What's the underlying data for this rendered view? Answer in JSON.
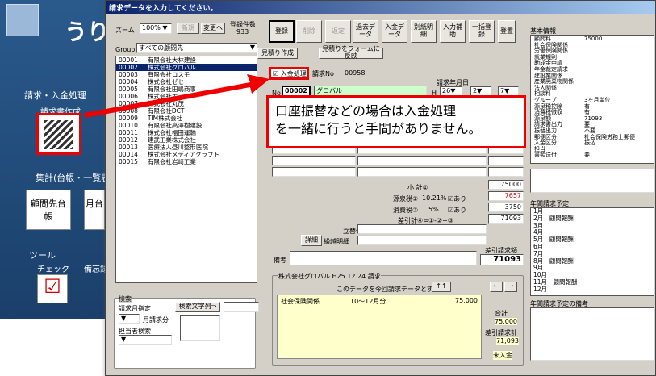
{
  "bg": {
    "title": "うり",
    "sec1": "請求・入金処理",
    "item1": "請求書作成",
    "sec2": "集計(台帳・一覧表",
    "item2": "顧問先台帳",
    "item2b": "月台",
    "sec3": "ツール",
    "item3": "チェック",
    "item3b": "備忘録"
  },
  "win": {
    "title": "請求データを入力してください。",
    "zoom_label": "ズーム",
    "zoom_val": "100%",
    "btn_new": "新規",
    "btn_change": "変更へ",
    "count_label": "登録件数",
    "count_val": "933",
    "group_label": "Group",
    "group_val": "すべての顧問先",
    "clients": [
      {
        "code": "00001",
        "name": "有限会社大林建設"
      },
      {
        "code": "00002",
        "name": "株式会社グロバル"
      },
      {
        "code": "00003",
        "name": "有限会社コスモ"
      },
      {
        "code": "00004",
        "name": "株式会社ゼセ"
      },
      {
        "code": "00005",
        "name": "有限会社田嶋商事"
      },
      {
        "code": "00006",
        "name": "株式会社ホーム"
      },
      {
        "code": "00007",
        "name": "株式会社丸茂"
      },
      {
        "code": "00008",
        "name": "有限会社DCT"
      },
      {
        "code": "00009",
        "name": "TIM株式会社"
      },
      {
        "code": "00010",
        "name": "有限会社高澤樹建設"
      },
      {
        "code": "00011",
        "name": "株式会社福田運輸"
      },
      {
        "code": "00012",
        "name": "建武工業株式会社"
      },
      {
        "code": "00013",
        "name": "医療法人昼川整形医院"
      },
      {
        "code": "00014",
        "name": "株式会社メディアクラフト"
      },
      {
        "code": "00015",
        "name": "有限会社岩崎工業"
      }
    ],
    "toolbar": [
      "登録",
      "削除",
      "返定",
      "過去データ",
      "入金データ",
      "別紙明細",
      "入力補助",
      "一括登録",
      "登置"
    ],
    "btn_estimate": "見積り作成",
    "btn_reflect": "見積りをフォームに反映",
    "chk_nyukin": "入金処理",
    "req_no_label": "請求No",
    "req_no": "00958",
    "no_label": "No",
    "no_val": "00002",
    "client_name": "グロバル",
    "year_label": "請求年月日",
    "h_label": "H",
    "y_val": "26",
    "m_val": "2",
    "d_val": "7",
    "callout1": "口座振替などの場合は入金処理",
    "callout2": "を一緒に行うと手間がありません。",
    "subtotal_label": "小 計①",
    "subtotal": "75000",
    "gensen_label": "源泉税②",
    "gensen_rate": "10.21%",
    "gensen_chk": "あり",
    "gensen": "7657",
    "tax_label": "消費税③",
    "tax_rate": "5%",
    "tax_chk": "あり",
    "tax": "3750",
    "sashi_label": "差引計④=①-②+③",
    "sashi": "71093",
    "tatekae_label": "立替他",
    "detail_btn": "詳細",
    "kurikoshi_label": "繰越明細",
    "note_label": "備考",
    "total_label": "差引請求額",
    "total": "71093",
    "prev_group": "株式会社グロバル H25.12.24 請求",
    "prev_copy": "このデータを今回請求データとする⇒",
    "prev_up": "↑↑",
    "prev_row": {
      "item": "社会保険関係",
      "period": "10～12月分",
      "amt": "75,000"
    },
    "prev_total_label": "合計",
    "prev_total": "75,000",
    "prev_sashi_label": "差引請求計",
    "prev_sashi": "71,093",
    "prev_status": "未入金",
    "search_title": "検索",
    "search_month_label": "請求月指定",
    "search_month_suffix": "月請求分",
    "search_text_btn": "検索文字列⇒",
    "search_staff_label": "担当者検索",
    "info_title": "基本情報",
    "info": [
      [
        "顧問料",
        "75000"
      ],
      [
        "社会保険関係",
        ""
      ],
      [
        "労働保険関係",
        ""
      ],
      [
        "就業規則",
        ""
      ],
      [
        "助成金申請",
        ""
      ],
      [
        "年金裁定請求",
        ""
      ],
      [
        "建設業関係",
        ""
      ],
      [
        "産業廃棄物関係",
        ""
      ],
      [
        "法人関係",
        ""
      ],
      [
        "相談料",
        ""
      ],
      [
        "グループ",
        "3ヶ月単位"
      ],
      [
        "源泉税控除",
        "有"
      ],
      [
        "消費税徴収",
        "有"
      ],
      [
        "源泉額",
        "71093"
      ],
      [
        "請求書出力",
        "要"
      ],
      [
        "振替出力",
        "不要"
      ],
      [
        "郵便区分",
        "社会保険労務士郵便"
      ],
      [
        "入金区分",
        "振込"
      ],
      [
        "担当",
        ""
      ],
      [
        "書類送付",
        "要"
      ]
    ],
    "annual_title": "年間請求予定",
    "annual": [
      "1月",
      "2月　顧問報酬",
      "3月",
      "4月",
      "5月　顧問報酬",
      "6月",
      "7月",
      "8月　顧問報酬",
      "9月",
      "10月",
      "11月　顧問報酬",
      "12月"
    ],
    "annual_note": "年間請求予定の備考"
  }
}
